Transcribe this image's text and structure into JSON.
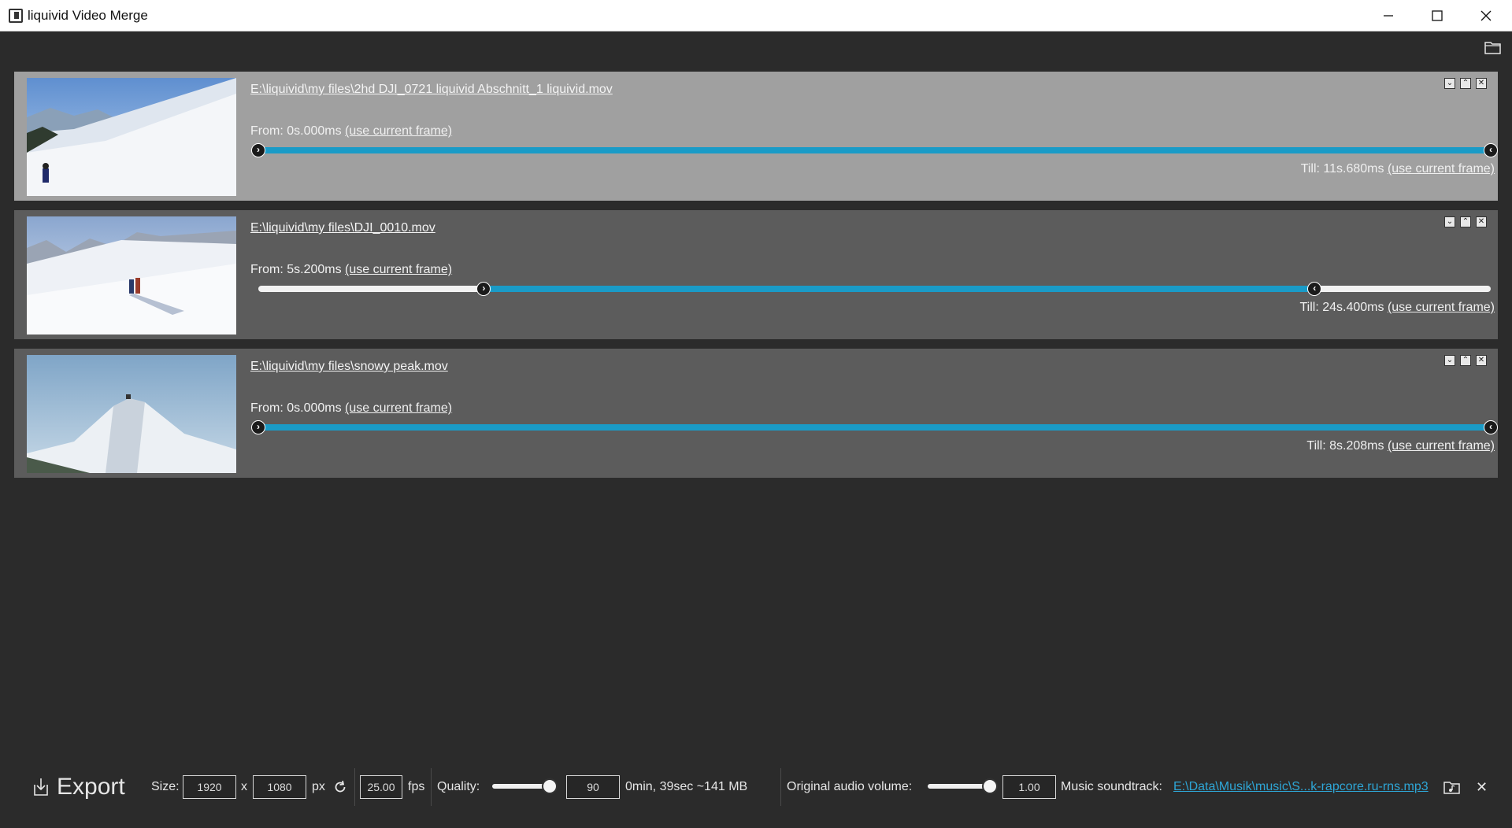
{
  "window": {
    "title": "liquivid Video Merge",
    "minimize": "—",
    "maximize": "☐",
    "close": "✕"
  },
  "clips": [
    {
      "path": "E:\\liquivid\\my files\\2hd DJI_0721 liquivid Abschnitt_1 liquivid.mov",
      "from_label": "From: 0s.000ms",
      "till_label": "Till: 11s.680ms",
      "use_current": "(use current frame)",
      "range_start": 0.0,
      "range_end": 1.0
    },
    {
      "path": "E:\\liquivid\\my files\\DJI_0010.mov",
      "from_label": "From: 5s.200ms",
      "till_label": "Till: 24s.400ms",
      "use_current": "(use current frame)",
      "range_start": 0.183,
      "range_end": 0.857
    },
    {
      "path": "E:\\liquivid\\my files\\snowy peak.mov",
      "from_label": "From: 0s.000ms",
      "till_label": "Till: 8s.208ms",
      "use_current": "(use current frame)",
      "range_start": 0.0,
      "range_end": 1.0
    }
  ],
  "card_buttons": {
    "down": "⌄",
    "up": "⌃",
    "remove": "✕"
  },
  "toolbar": {
    "export_label": "Export",
    "size_label": "Size:",
    "width": "1920",
    "x_label": "x",
    "height": "1080",
    "px_label": "px",
    "fps": "25.00",
    "fps_label": "fps",
    "quality_label": "Quality:",
    "quality_value": "90",
    "quality_level": 1.0,
    "estimate": "0min, 39sec ~141 MB",
    "audio_label": "Original audio volume:",
    "audio_value": "1.00",
    "audio_level": 1.0,
    "music_label": "Music soundtrack:",
    "music_file": "E:\\Data\\Musik\\music\\S...k-rapcore.ru-rns.mp3",
    "clear_music": "✕"
  },
  "colors": {
    "background": "#2b2b2b",
    "card_selected": "#a0a0a0",
    "card": "#5c5c5c",
    "accent": "#1a9bc7",
    "link": "#2ea6d6"
  }
}
